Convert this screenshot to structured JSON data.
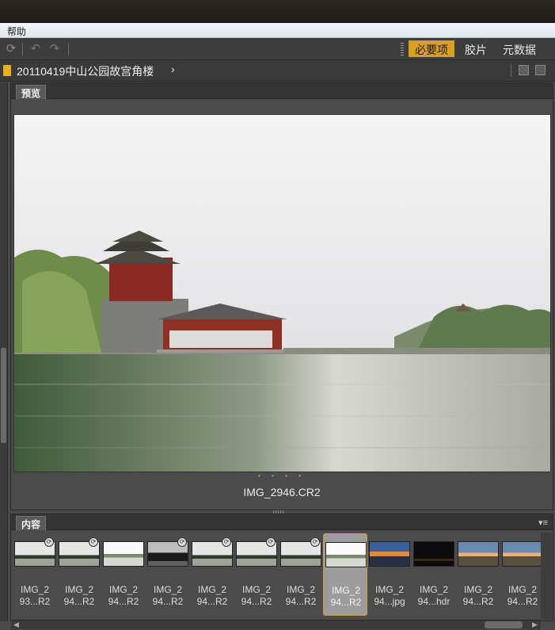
{
  "menubar": {
    "help_label": "帮助"
  },
  "toolbar": {
    "workspaces": [
      {
        "label": "必要项",
        "active": true
      },
      {
        "label": "胶片",
        "active": false
      },
      {
        "label": "元数据",
        "active": false
      }
    ],
    "accent_color": "#d9a020"
  },
  "path": {
    "folder": "20110419中山公园故宫角楼",
    "chevron": "›"
  },
  "preview": {
    "tab_label": "预览",
    "filename": "IMG_2946.CR2",
    "dots": "• • • •"
  },
  "content": {
    "tab_label": "内容",
    "thumbnails": [
      {
        "line1": "IMG_2",
        "line2": "93...R2",
        "kind": "dusk",
        "badge": true,
        "selected": false
      },
      {
        "line1": "IMG_2",
        "line2": "94...R2",
        "kind": "dusk",
        "badge": true,
        "selected": false
      },
      {
        "line1": "IMG_2",
        "line2": "94...R2",
        "kind": "bright",
        "badge": false,
        "selected": false
      },
      {
        "line1": "IMG_2",
        "line2": "94...R2",
        "kind": "dark",
        "badge": true,
        "selected": false
      },
      {
        "line1": "IMG_2",
        "line2": "94...R2",
        "kind": "dusk",
        "badge": true,
        "selected": false
      },
      {
        "line1": "IMG_2",
        "line2": "94...R2",
        "kind": "dusk",
        "badge": true,
        "selected": false
      },
      {
        "line1": "IMG_2",
        "line2": "94...R2",
        "kind": "dusk",
        "badge": true,
        "selected": false
      },
      {
        "line1": "IMG_2",
        "line2": "94...R2",
        "kind": "bright",
        "badge": false,
        "selected": true
      },
      {
        "line1": "IMG_2",
        "line2": "94...jpg",
        "kind": "sunset",
        "badge": false,
        "selected": false
      },
      {
        "line1": "IMG_2",
        "line2": "94...hdr",
        "kind": "night",
        "badge": false,
        "selected": false
      },
      {
        "line1": "IMG_2",
        "line2": "94...R2",
        "kind": "sunset2",
        "badge": false,
        "selected": false
      },
      {
        "line1": "IMG_2",
        "line2": "94...R2",
        "kind": "sunset2",
        "badge": false,
        "selected": false
      }
    ]
  }
}
